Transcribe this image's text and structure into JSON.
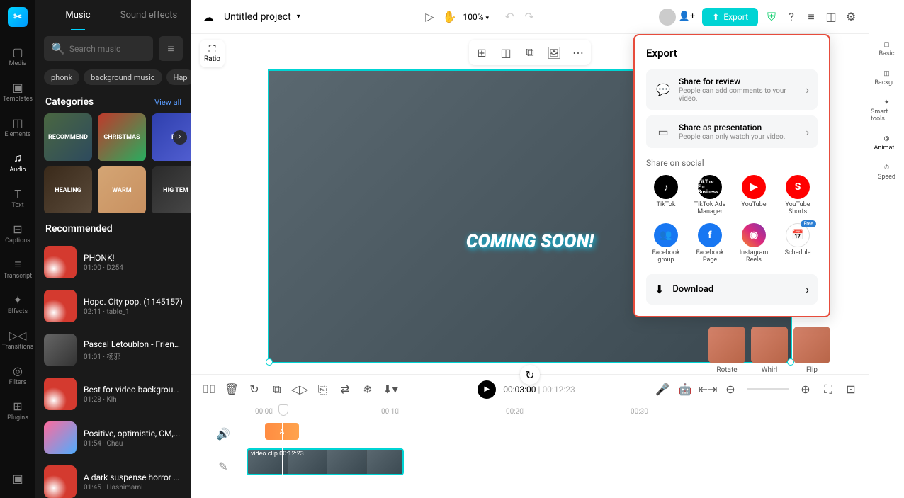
{
  "app": {
    "name": "CapCut"
  },
  "topbar": {
    "project_title": "Untitled project",
    "zoom": "100%",
    "export_label": "Export"
  },
  "far_nav": {
    "items": [
      {
        "label": "Media"
      },
      {
        "label": "Templates"
      },
      {
        "label": "Elements"
      },
      {
        "label": "Audio"
      },
      {
        "label": "Text"
      },
      {
        "label": "Captions"
      },
      {
        "label": "Transcript"
      },
      {
        "label": "Effects"
      },
      {
        "label": "Transitions"
      },
      {
        "label": "Filters"
      },
      {
        "label": "Plugins"
      }
    ]
  },
  "left_panel": {
    "tabs": {
      "music": "Music",
      "sfx": "Sound effects"
    },
    "search_placeholder": "Search music",
    "chips": [
      "phonk",
      "background music",
      "Hap"
    ],
    "categories_title": "Categories",
    "view_all": "View all",
    "categories": [
      "RECOMMEND",
      "CHRISTMAS",
      "PO",
      "HEALING",
      "WARM",
      "HIG TEM"
    ],
    "recommended_title": "Recommended",
    "tracks": [
      {
        "title": "PHONK!",
        "meta": "01:00 · D254",
        "thumb": "red"
      },
      {
        "title": "Hope. City pop. (1145157)",
        "meta": "02:11 · table_1",
        "thumb": "red"
      },
      {
        "title": "Pascal Letoublon - Friendships...",
        "meta": "01:01 · 杨邪",
        "thumb": "photo"
      },
      {
        "title": "Best for video background music...",
        "meta": "01:28 · Klh",
        "thumb": "red"
      },
      {
        "title": "Positive, optimistic, CM,...",
        "meta": "01:54 · Chau",
        "thumb": "gradient"
      },
      {
        "title": "A dark suspense horror song with a...",
        "meta": "01:45 · Hashimami",
        "thumb": "red"
      }
    ]
  },
  "preview": {
    "ratio_label": "Ratio",
    "overlay_text": "COMING SOON!"
  },
  "timeline": {
    "current": "00:03:00",
    "total": "00:12:23",
    "ruler": [
      "00:00",
      "00:10",
      "00:20",
      "00:30"
    ],
    "text_clip_label": "A",
    "video_clip_label": "video clip   00:12:23"
  },
  "right_panel": {
    "items": [
      {
        "label": "Basic"
      },
      {
        "label": "Backgr..."
      },
      {
        "label": "Smart tools"
      },
      {
        "label": "Animat..."
      },
      {
        "label": "Speed"
      }
    ]
  },
  "anim_thumbs": [
    "Rotate",
    "Whirl",
    "Flip"
  ],
  "export_popup": {
    "title": "Export",
    "share_review": {
      "title": "Share for review",
      "sub": "People can add comments to your video."
    },
    "share_presentation": {
      "title": "Share as presentation",
      "sub": "People can only watch your video."
    },
    "social_title": "Share on social",
    "social": [
      {
        "label": "TikTok"
      },
      {
        "label": "TikTok Ads Manager"
      },
      {
        "label": "YouTube"
      },
      {
        "label": "YouTube Shorts"
      },
      {
        "label": "Facebook group"
      },
      {
        "label": "Facebook Page"
      },
      {
        "label": "Instagram Reels"
      },
      {
        "label": "Schedule"
      }
    ],
    "free_badge": "Free",
    "download_label": "Download"
  }
}
